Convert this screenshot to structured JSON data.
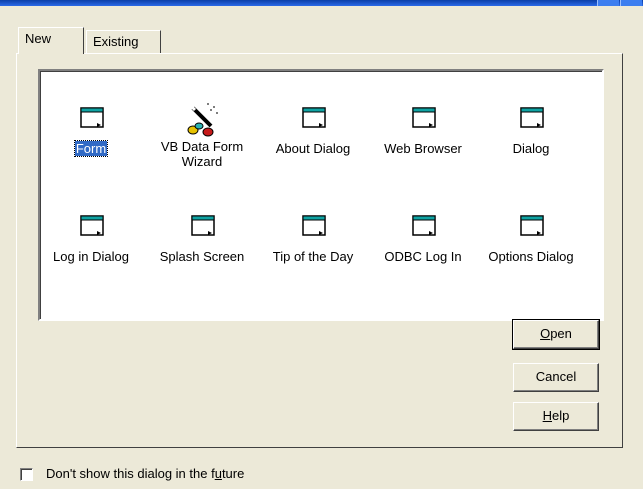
{
  "tabs": [
    {
      "label": "New",
      "active": true
    },
    {
      "label": "Existing",
      "active": false
    }
  ],
  "items": [
    {
      "label": "Form",
      "icon": "form-icon",
      "selected": true
    },
    {
      "label": "VB Data Form Wizard",
      "line1": "VB Data Form",
      "line2": "Wizard",
      "icon": "wizard-wand-icon"
    },
    {
      "label": "About Dialog",
      "icon": "form-icon"
    },
    {
      "label": "Web Browser",
      "icon": "form-icon"
    },
    {
      "label": "Dialog",
      "icon": "form-icon"
    },
    {
      "label": "Log in Dialog",
      "icon": "form-icon"
    },
    {
      "label": "Splash Screen",
      "icon": "form-icon"
    },
    {
      "label": "Tip of the Day",
      "icon": "form-icon"
    },
    {
      "label": "ODBC Log In",
      "icon": "form-icon"
    },
    {
      "label": "Options Dialog",
      "icon": "form-icon"
    }
  ],
  "buttons": {
    "open": {
      "pre": "",
      "accel": "O",
      "post": "pen"
    },
    "cancel": {
      "label": "Cancel"
    },
    "help": {
      "pre": "",
      "accel": "H",
      "post": "elp"
    }
  },
  "checkbox": {
    "pre": "Don't show this dialog in the f",
    "accel": "u",
    "post": "ture",
    "checked": false
  },
  "colors": {
    "face": "#ece9d8",
    "selection": "#316ac5",
    "icon_titlebar": "#0fa3a3"
  }
}
